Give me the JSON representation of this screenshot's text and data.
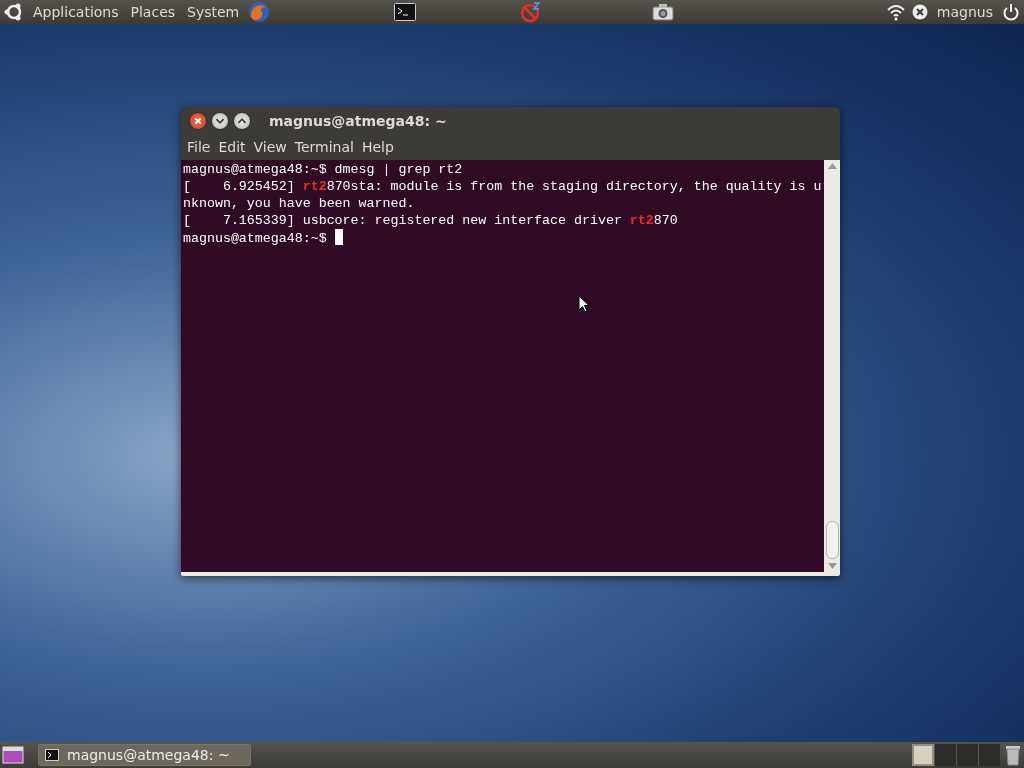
{
  "top_panel": {
    "menus": [
      "Applications",
      "Places",
      "System"
    ],
    "user": "magnus"
  },
  "window": {
    "title": "magnus@atmega48: ~",
    "menu": [
      "File",
      "Edit",
      "View",
      "Terminal",
      "Help"
    ],
    "lines": [
      [
        {
          "text": "magnus@atmega48:~$ dmesg | grep rt2",
          "highlight": false
        }
      ],
      [
        {
          "text": "[    6.925452] ",
          "highlight": false
        },
        {
          "text": "rt2",
          "highlight": true
        },
        {
          "text": "870sta: module is from the staging directory, the quality is u",
          "highlight": false
        }
      ],
      [
        {
          "text": "nknown, you have been warned.",
          "highlight": false
        }
      ],
      [
        {
          "text": "[    7.165339] usbcore: registered new interface driver ",
          "highlight": false
        },
        {
          "text": "rt2",
          "highlight": true
        },
        {
          "text": "870",
          "highlight": false
        }
      ],
      [
        {
          "text": "magnus@atmega48:~$ ",
          "highlight": false
        }
      ]
    ]
  },
  "bottom_panel": {
    "tasks": [
      {
        "label": "magnus@atmega48: ~",
        "selected": false
      }
    ],
    "workspaces": [
      {
        "selected": true
      },
      {
        "selected": false
      },
      {
        "selected": false
      },
      {
        "selected": false
      }
    ]
  }
}
